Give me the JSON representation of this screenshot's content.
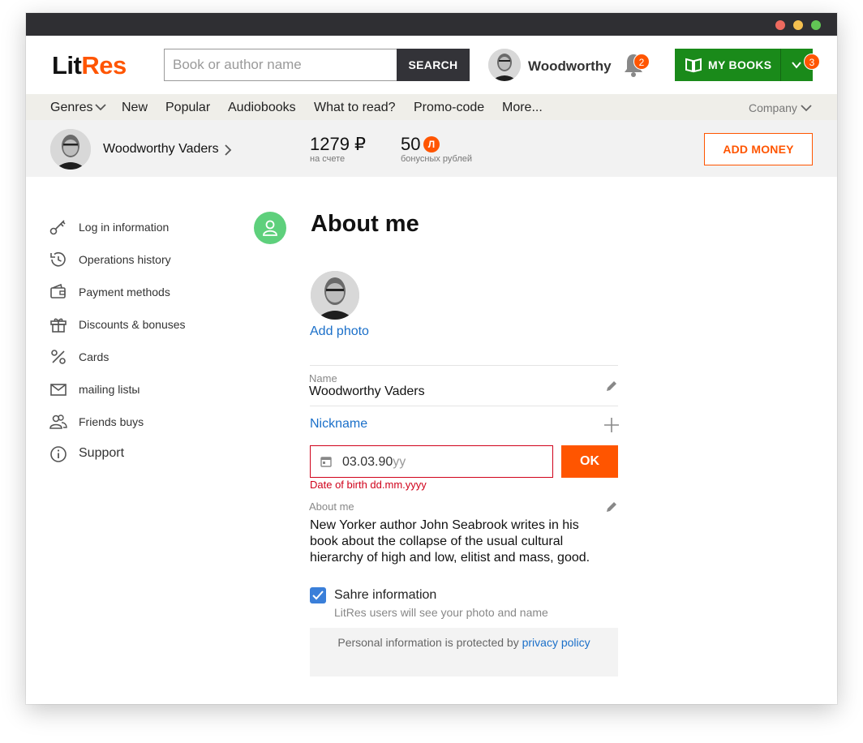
{
  "header": {
    "logo_lit": "Lit",
    "logo_res": "Res",
    "search_placeholder": "Book or author name",
    "search_button": "SEARCH",
    "username": "Woodworthy",
    "notifications_count": "2",
    "my_books_label": "MY BOOKS",
    "my_books_count": "3"
  },
  "nav": {
    "items": [
      "Genres",
      "New",
      "Popular",
      "Audiobooks",
      "What to read?",
      "Promo-code",
      "More..."
    ],
    "company": "Company"
  },
  "account": {
    "name": "Woodworthy Vaders",
    "balance": "1279 ₽",
    "balance_caption": "на счете",
    "bonus": "50",
    "bonus_coin": "Л",
    "bonus_caption": "бонусных рублей",
    "add_money": "ADD MONEY"
  },
  "sidebar": {
    "items": [
      {
        "label": "Log in information",
        "icon": "key-icon"
      },
      {
        "label": "Operations history",
        "icon": "history-icon"
      },
      {
        "label": "Payment methods",
        "icon": "wallet-icon"
      },
      {
        "label": "Discounts & bonuses",
        "icon": "gift-icon"
      },
      {
        "label": "Cards",
        "icon": "percent-icon"
      },
      {
        "label": "mailing listы",
        "icon": "mail-icon"
      },
      {
        "label": "Friends buys",
        "icon": "friends-icon"
      },
      {
        "label": "Support",
        "icon": "info-icon"
      }
    ]
  },
  "profile": {
    "title": "About me",
    "add_photo": "Add photo",
    "name_label": "Name",
    "name_value": "Woodworthy Vaders",
    "nickname_label": "Nickname",
    "date_value": "03.03.90",
    "date_mask_rest": "yy",
    "ok_button": "OK",
    "date_error": "Date of birth dd.mm.yyyy",
    "about_label": "About me",
    "about_text": "New Yorker author John Seabrook writes in his book about the collapse of the usual cultural hierarchy of high and low, elitist and mass, good.",
    "share_checked": true,
    "share_label": "Sahre information",
    "share_sub": "LitRes users will see your photo and name",
    "privacy_text": "Personal information is protected by ",
    "privacy_link": "privacy policy"
  },
  "colors": {
    "brand_orange": "#ff5500",
    "green": "#1a8a1a",
    "link_blue": "#1a6fc9",
    "error_red": "#d0021b",
    "profile_badge_green": "#5ed07c"
  }
}
